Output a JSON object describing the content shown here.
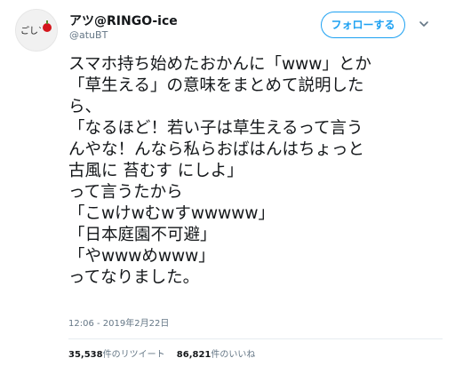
{
  "tweet": {
    "author": {
      "avatar_text": "ごし`",
      "display_name": "アツ@RINGO-ice",
      "handle": "@atuBT"
    },
    "follow_label": "フォローする",
    "more_icon": "chevron-down-icon",
    "lines": [
      "スマホ持ち始めたおかんに「www」とか",
      "「草生える」の意味をまとめて説明した",
      "ら、",
      "「なるほど！若い子は草生えるって言う",
      "んやな！んなら私らおばはんはちょっと",
      "古風に 苔むす にしよ」",
      "って言うたから",
      "「こwけwむwすwwwww」",
      "「日本庭園不可避」",
      "「やwwwめwww」",
      "ってなりました。"
    ],
    "timestamp": "12:06 - 2019年2月22日",
    "retweets": {
      "count": "35,538",
      "label": "件のリツイート"
    },
    "likes": {
      "count": "86,821",
      "label": "件のいいね"
    }
  },
  "colors": {
    "accent": "#1da1f2",
    "text": "#14171a",
    "muted": "#657786",
    "divider": "#e6ecf0",
    "apple": "#d4161b"
  }
}
